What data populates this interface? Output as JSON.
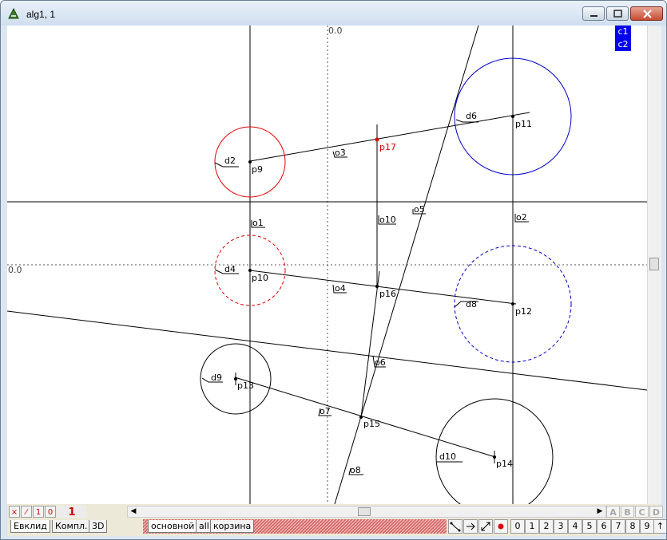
{
  "window": {
    "title": "alg1, 1"
  },
  "canvas": {
    "axis_label_top": "0.0",
    "axis_label_left": "0.0"
  },
  "legend": [
    "c1",
    "c2"
  ],
  "geometry_labels": {
    "p9": "p9",
    "p10": "p10",
    "p11": "p11",
    "p12": "p12",
    "p13": "p13",
    "p14": "p14",
    "p15": "p15",
    "p16": "p16",
    "p17": "p17",
    "d2": "d2",
    "d4": "d4",
    "d6": "d6",
    "d8": "d8",
    "d9": "d9",
    "d10": "d10",
    "o1": "o1",
    "o2": "o2",
    "o3": "o3",
    "o4": "o4",
    "o5": "o5",
    "o6": "o6",
    "o7": "o7",
    "o8": "o8",
    "o10": "o10"
  },
  "toolbar_left": {
    "delete_label": "×",
    "line_label": "⁄",
    "one_label": "1",
    "zero_label": "0",
    "big_one_label": "1"
  },
  "tabs_left": [
    "Евклид",
    "Компл.",
    "3D"
  ],
  "tabs_right": [
    "основной",
    "all",
    "корзина"
  ],
  "letter_buttons": [
    "A",
    "B",
    "C",
    "D"
  ],
  "number_buttons": [
    "0",
    "1",
    "2",
    "3",
    "4",
    "5",
    "6",
    "7",
    "8",
    "9",
    "↑"
  ]
}
